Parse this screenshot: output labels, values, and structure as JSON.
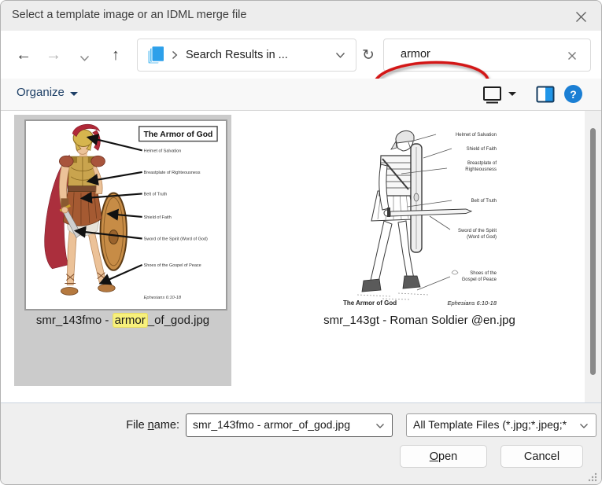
{
  "colors": {
    "annotation_red": "#d31616",
    "highlight_yellow": "#f7f07b",
    "selection_gray": "#cbcbcb",
    "organize_blue": "#1d3f66",
    "help_blue": "#1b7fd4",
    "icon_blue": "#2da0ea"
  },
  "title_bar": {
    "title": "Select a template image or an IDML merge file"
  },
  "nav": {
    "back_glyph": "←",
    "forward_glyph": "→",
    "up_glyph": "↑",
    "refresh_glyph": "↻",
    "address": {
      "location": "Search Results in ..."
    },
    "search": {
      "value": "armor"
    }
  },
  "command_bar": {
    "organize_label": "Organize",
    "help_glyph": "?"
  },
  "files": {
    "item1": {
      "name_prefix": "smr_143fmo - ",
      "name_highlight": "armor",
      "name_suffix": "_of_god.jpg"
    },
    "item2": {
      "name": "smr_143gt - Roman Soldier @en.jpg"
    }
  },
  "thumb1": {
    "title": "The Armor of God",
    "labels": [
      "Helmet of Salvation",
      "Breastplate of Righteousness",
      "Belt of Truth",
      "Shield of Faith",
      "Sword of the Spirit (Word of God)",
      "Shoes of the Gospel of Peace"
    ],
    "verse": "Ephesians 6:10-18"
  },
  "thumb2": {
    "labels": [
      "Helmet of Salvation",
      "Shield of Faith",
      "Breastplate of",
      "Righteousness",
      "Belt of Truth",
      "Sword of the Spirit",
      "(Word of God)",
      "Shoes of the",
      "Gospel of Peace"
    ],
    "caption": "The Armor of God",
    "verse": "Ephesians 6:10-18"
  },
  "footer": {
    "file_name_label_pre": "File ",
    "file_name_label_accel": "n",
    "file_name_label_post": "ame:",
    "file_name_value": "smr_143fmo - armor_of_god.jpg",
    "file_type_value": "All Template Files (*.jpg;*.jpeg;*",
    "open_accel": "O",
    "open_rest": "pen",
    "cancel_label": "Cancel"
  }
}
